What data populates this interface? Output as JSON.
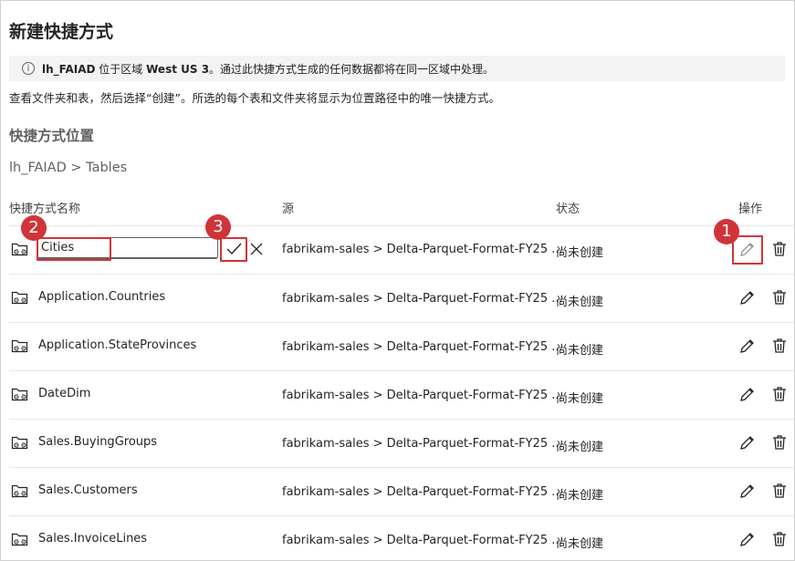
{
  "dialog": {
    "title": "新建快捷方式"
  },
  "banner": {
    "icon": "info-icon",
    "workspace": "lh_FAIAD",
    "text_a": " 位于区域 ",
    "region": "West US 3",
    "text_b": "。通过此快捷方式生成的任何数据都将在同一区域中处理。"
  },
  "description": "查看文件夹和表，然后选择“创建”。所选的每个表和文件夹将显示为位置路径中的唯一快捷方式。",
  "location": {
    "heading": "快捷方式位置",
    "breadcrumb": "lh_FAIAD > Tables"
  },
  "table": {
    "headers": {
      "name": "快捷方式名称",
      "source": "源",
      "status": "状态",
      "actions": "操作"
    },
    "editing_row": {
      "input_value": "Cities",
      "source": "fabrikam-sales > Delta-Parquet-Format-FY25 ...",
      "status": "尚未创建"
    },
    "rows": [
      {
        "name": "Application.Countries",
        "source": "fabrikam-sales > Delta-Parquet-Format-FY25 ...",
        "status": "尚未创建"
      },
      {
        "name": "Application.StateProvinces",
        "source": "fabrikam-sales > Delta-Parquet-Format-FY25 ...",
        "status": "尚未创建"
      },
      {
        "name": "DateDim",
        "source": "fabrikam-sales > Delta-Parquet-Format-FY25 ...",
        "status": "尚未创建"
      },
      {
        "name": "Sales.BuyingGroups",
        "source": "fabrikam-sales > Delta-Parquet-Format-FY25 ...",
        "status": "尚未创建"
      },
      {
        "name": "Sales.Customers",
        "source": "fabrikam-sales > Delta-Parquet-Format-FY25 ...",
        "status": "尚未创建"
      },
      {
        "name": "Sales.InvoiceLines",
        "source": "fabrikam-sales > Delta-Parquet-Format-FY25 ...",
        "status": "尚未创建"
      }
    ]
  },
  "callouts": {
    "one": "1",
    "two": "2",
    "three": "3"
  },
  "colors": {
    "callout_red": "#d13438",
    "text": "#242424",
    "muted": "#616161"
  }
}
